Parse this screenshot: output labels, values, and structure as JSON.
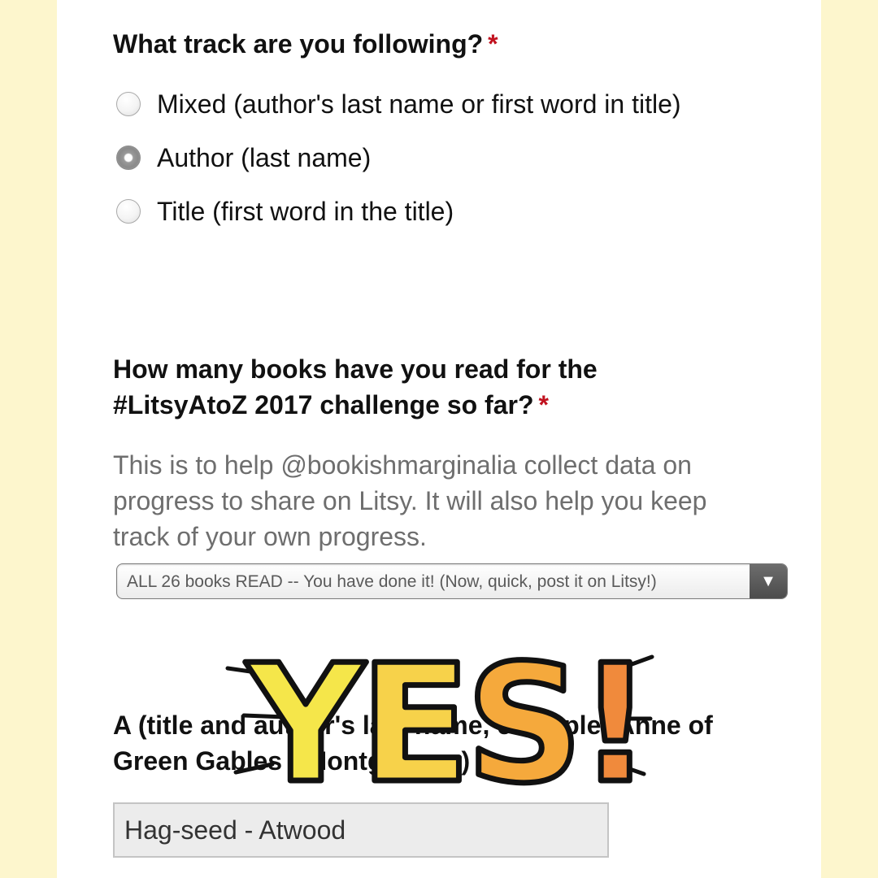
{
  "track_question": {
    "label": "What track are you following?",
    "required_mark": "*",
    "options": [
      {
        "label": "Mixed (author's last name or first word in title)",
        "selected": false
      },
      {
        "label": "Author (last name)",
        "selected": true
      },
      {
        "label": "Title (first word in the title)",
        "selected": false
      }
    ]
  },
  "books_question": {
    "label_line1": "How many books have you read for the",
    "label_line2": "#LitsyAtoZ 2017 challenge so far?",
    "required_mark": "*",
    "help_line1": "This is to help @bookishmarginalia collect data on",
    "help_line2": "progress to share on Litsy. It will also help you keep",
    "help_line3": "track of your own progress.",
    "select_value": "ALL 26 books READ -- You have done it! (Now, quick, post it on Litsy!)",
    "select_arrow": "▼"
  },
  "a_question": {
    "label_line1": "A (title and author's last name, example: Anne of",
    "label_line2": "Green Gables - Montgomery)",
    "input_value": "Hag-seed - Atwood"
  },
  "sticker": {
    "text": "YES!",
    "colors": [
      "#f5e64a",
      "#f7b93c",
      "#f08a3c"
    ]
  }
}
